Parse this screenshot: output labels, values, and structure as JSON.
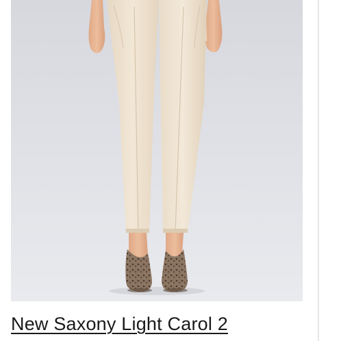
{
  "product": {
    "name": "New Saxony Light Carol 2",
    "image_alt": "Model wearing cream ankle-length trousers with leopard-print heels"
  },
  "colors": {
    "background": "#ffffff",
    "image_background": "#e3e5ea",
    "trouser": "#efe3d1",
    "skin": "#e8b896",
    "shoe": "#7a6654",
    "text": "#1a1a1a",
    "divider": "#e6e6e6"
  }
}
